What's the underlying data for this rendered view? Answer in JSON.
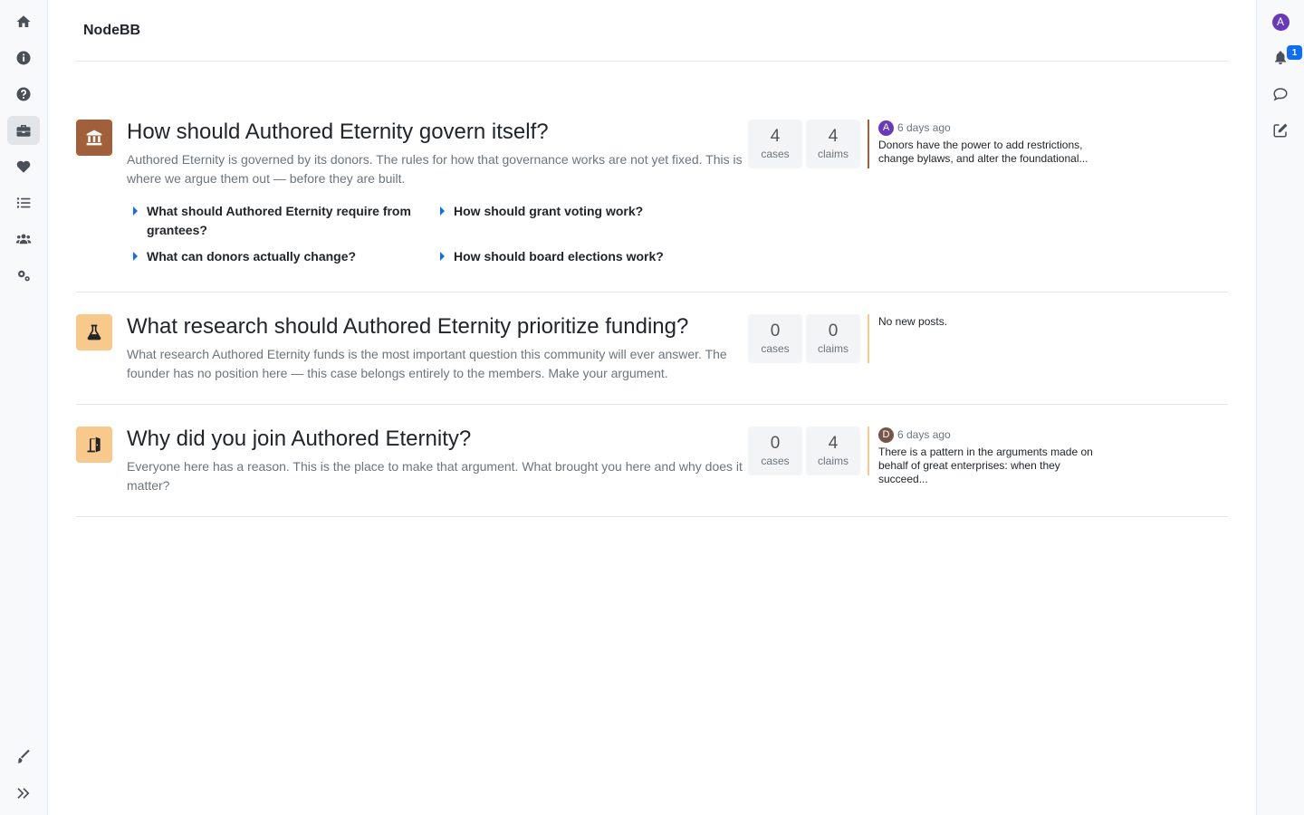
{
  "app": {
    "brand": "NodeBB"
  },
  "left_nav": [
    {
      "icon": "home-icon"
    },
    {
      "icon": "info-icon"
    },
    {
      "icon": "help-icon"
    },
    {
      "icon": "briefcase-icon",
      "active": true
    },
    {
      "icon": "heart-icon"
    },
    {
      "icon": "list-icon"
    },
    {
      "icon": "users-icon"
    },
    {
      "icon": "cogs-icon"
    }
  ],
  "left_bottom": [
    {
      "icon": "brush-icon"
    },
    {
      "icon": "expand-icon"
    }
  ],
  "right_nav": {
    "user_initial": "A",
    "notification_count": "1"
  },
  "categories": [
    {
      "title": "How should Authored Eternity govern itself?",
      "description": "Authored Eternity is governed by its donors. The rules for how that governance works are not yet fixed. This is where we argue them out — before they are built.",
      "icon": "landmark-icon",
      "icon_bg": "#a0613a",
      "cases": "4",
      "cases_label": "cases",
      "claims": "4",
      "claims_label": "claims",
      "teaser": {
        "initial": "A",
        "avatar_color": "#673ab7",
        "time": "6 days ago",
        "text": "Donors have the power to add restrictions, change bylaws, and alter the foundational..."
      },
      "subcategories": [
        "What should Authored Eternity require from grantees?",
        "How should grant voting work?",
        "What can donors actually change?",
        "How should board elections work?"
      ]
    },
    {
      "title": "What research should Authored Eternity prioritize funding?",
      "description": "What research Authored Eternity funds is the most important question this community will ever answer. The founder has no position here — this case belongs entirely to the members. Make your argument.",
      "icon": "flask-icon",
      "icon_bg": "#f8c98a",
      "cases": "0",
      "cases_label": "cases",
      "claims": "0",
      "claims_label": "claims",
      "teaser": {
        "text": "No new posts."
      }
    },
    {
      "title": "Why did you join Authored Eternity?",
      "description": "Everyone here has a reason. This is the place to make that argument. What brought you here and why does it matter?",
      "icon": "door-open-icon",
      "icon_bg": "#f8c98a",
      "cases": "0",
      "cases_label": "cases",
      "claims": "4",
      "claims_label": "claims",
      "teaser": {
        "initial": "D",
        "avatar_color": "#795548",
        "time": "6 days ago",
        "text": "There is a pattern in the arguments made on behalf of great enterprises: when they succeed..."
      }
    }
  ]
}
